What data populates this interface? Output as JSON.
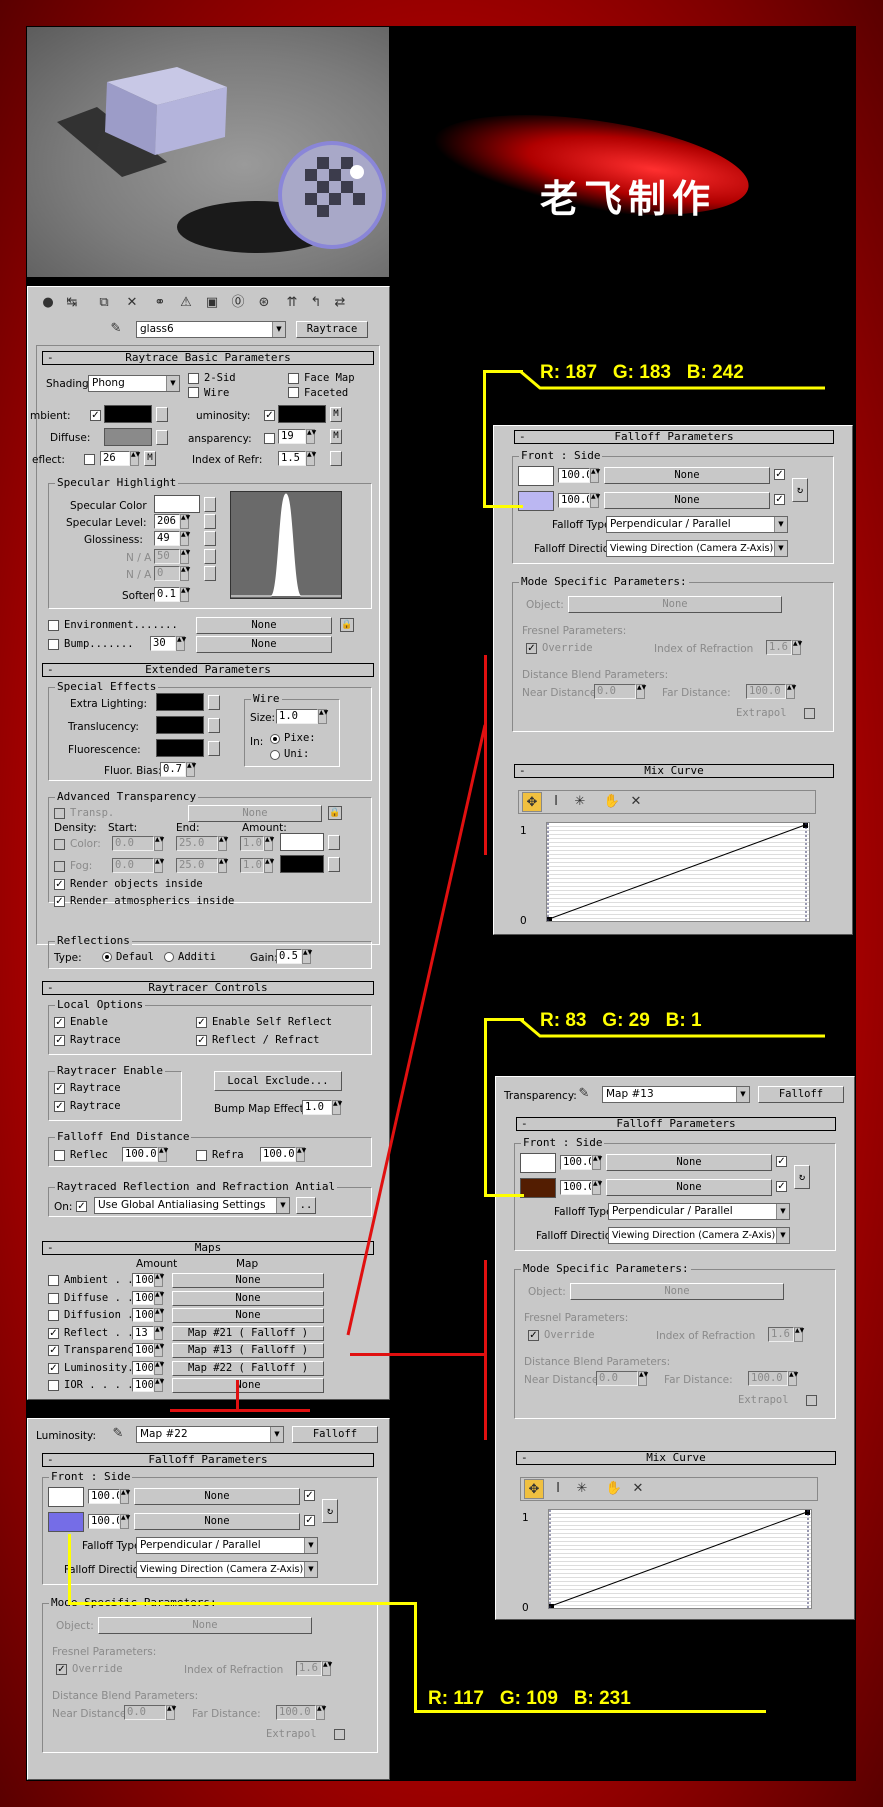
{
  "title_chinese": "老飞制作",
  "rgb_labels": {
    "reflect": "R: 187   G: 183   B: 242",
    "transparency": "R: 83   G: 29   B: 1",
    "luminosity": "R: 117   G: 109   B: 231"
  },
  "colors": {
    "reflect_side": "#bbb7f2",
    "transparency_side": "#531d01",
    "luminosity_side": "#756de7",
    "frame": "#d00000",
    "annotation": "#ffff00"
  },
  "toolbar_icons": [
    "get-material-icon",
    "put-to-scene-icon",
    "assign-icon",
    "reset-icon",
    "copy-icon",
    "unique-icon",
    "put-library-icon",
    "material-id-icon",
    "show-map-icon",
    "show-end-icon",
    "go-parent-icon",
    "go-sibling-icon"
  ],
  "material": {
    "name": "glass6",
    "type": "Raytrace"
  },
  "basic": {
    "title": "Raytrace Basic Parameters",
    "shading_label": "Shading:",
    "shading_value": "Phong",
    "two_sided": "2-Sid",
    "wire": "Wire",
    "face_map": "Face Map",
    "faceted": "Faceted",
    "ambient": "mbient:",
    "luminosity": "uminosity:",
    "diffuse": "Diffuse:",
    "transparency": "ansparency:",
    "transparency_value": "19",
    "reflect": "eflect:",
    "reflect_value": "26",
    "ior_label": "Index of Refr:",
    "ior_value": "1.5",
    "m": "M",
    "spec_group": "Specular Highlight",
    "spec_color": "Specular Color",
    "spec_level": "Specular Level:",
    "spec_level_value": "206",
    "gloss": "Glossiness:",
    "gloss_value": "49",
    "na": "N / A",
    "na1": "50",
    "na2": "0",
    "soften": "Soften",
    "soften_value": "0.1",
    "environment": "Environment.......",
    "bump": "Bump.......",
    "bump_value": "30",
    "none": "None"
  },
  "extended": {
    "title": "Extended Parameters",
    "special": "Special Effects",
    "extra": "Extra Lighting:",
    "transl": "Translucency:",
    "fluor": "Fluorescence:",
    "fluor_bias": "Fluor. Bias:",
    "fluor_bias_value": "0.7",
    "wire": "Wire",
    "size": "Size:",
    "size_value": "1.0",
    "in": "In:",
    "pixels": "Pixe:",
    "units": "Uni:",
    "adv": "Advanced Transparency",
    "transp": "Transp.",
    "none": "None",
    "density": "Density:",
    "start": "Start:",
    "end": "End:",
    "amount": "Amount:",
    "color": "Color:",
    "fog": "Fog:",
    "v0": "0.0",
    "v25": "25.0",
    "v1": "1.0",
    "render_objects": "Render objects inside",
    "render_atmos": "Render atmospherics inside",
    "reflections": "Reflections",
    "type": "Type:",
    "default": "Defaul",
    "additive": "Additi",
    "gain": "Gain:",
    "gain_value": "0.5"
  },
  "rtc": {
    "title": "Raytracer Controls",
    "local": "Local Options",
    "enable": "Enable",
    "raytrace": "Raytrace",
    "self_reflect": "Enable Self Reflect",
    "reflect_refract": "Reflect / Refract",
    "rt_enable": "Raytracer Enable",
    "rt1": "Raytrace",
    "rt2": "Raytrace",
    "local_exclude": "Local Exclude...",
    "bump_effect": "Bump Map Effect :",
    "bump_effect_value": "1.0",
    "falloff_end": "Falloff End Distance",
    "reflect": "Reflec",
    "refract": "Refra",
    "v100": "100.0",
    "aa": "Raytraced Reflection and Refraction Antial",
    "on": "On:",
    "aa_value": "Use Global Antialiasing Settings",
    "dots": ".."
  },
  "maps": {
    "title": "Maps",
    "amount": "Amount",
    "map": "Map",
    "rows": [
      {
        "label": "Ambient . .",
        "amount": "100",
        "map": "None",
        "on": false
      },
      {
        "label": "Diffuse . .",
        "amount": "100",
        "map": "None",
        "on": false
      },
      {
        "label": "Diffusion .",
        "amount": "100",
        "map": "None",
        "on": false
      },
      {
        "label": "Reflect . .",
        "amount": "13",
        "map": "Map #21  ( Falloff )",
        "on": true
      },
      {
        "label": "Transparenc",
        "amount": "100",
        "map": "Map #13  ( Falloff )",
        "on": true
      },
      {
        "label": "Luminosity.",
        "amount": "100",
        "map": "Map #22  ( Falloff )",
        "on": true
      },
      {
        "label": "IOR . . . .",
        "amount": "100",
        "map": "None",
        "on": false
      }
    ]
  },
  "falloff": {
    "title": "Falloff Parameters",
    "front_side": "Front : Side",
    "v100": "100.0",
    "none": "None",
    "type_label": "Falloff Type:",
    "type_value": "Perpendicular / Parallel",
    "dir_label": "Falloff Direction:",
    "dir_value": "Viewing Direction (Camera Z-Axis)",
    "mode": "Mode Specific Parameters:",
    "object": "Object:",
    "fresnel": "Fresnel Parameters:",
    "override": "Override",
    "ior": "Index of Refraction",
    "ior_value": "1.6",
    "distance": "Distance Blend Parameters:",
    "near": "Near Distance:",
    "near_value": "0.0",
    "far": "Far Distance:",
    "far_value": "100.0",
    "extrapol": "Extrapol",
    "mix": "Mix Curve",
    "c1": "1",
    "c0": "0"
  },
  "header_trans": {
    "label": "Transparency:",
    "map": "Map #13",
    "type": "Falloff"
  },
  "header_lum": {
    "label": "Luminosity:",
    "map": "Map #22",
    "type": "Falloff"
  }
}
